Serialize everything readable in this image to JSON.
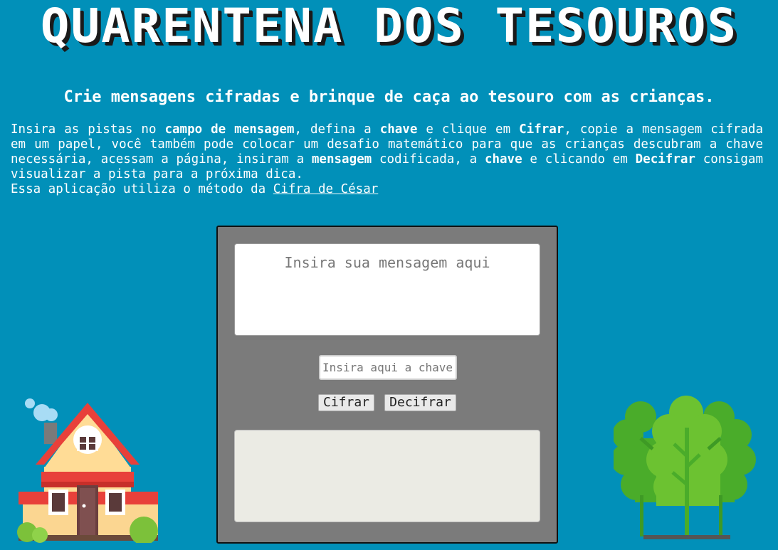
{
  "header": {
    "logo_text": "QUARENTENA DOS TESOUROS",
    "subtitle": "Crie mensagens cifradas e brinque de caça ao tesouro com as crianças."
  },
  "intro": {
    "t1": "Insira as pistas no ",
    "b1": "campo de mensagem",
    "t2": ", defina a ",
    "b2": "chave",
    "t3": " e clique em ",
    "b3": "Cifrar",
    "t4": ", copie a mensagem cifrada em um papel, você também pode colocar um desafio matemático para que as crianças descubram a chave necessária, acessam a página, insiram a ",
    "b4": "mensagem",
    "t5": " codificada, a ",
    "b5": "chave",
    "t6": " e clicando em ",
    "b6": "Decifrar",
    "t7": " consigam visualizar a pista para a próxima dica.",
    "t8": "Essa aplicação utiliza o método da ",
    "link": "Cifra de César"
  },
  "form": {
    "message_placeholder": "Insira sua mensagem aqui",
    "key_placeholder": "Insira aqui a chave",
    "encrypt_label": "Cifrar",
    "decrypt_label": "Decifrar",
    "output_value": ""
  },
  "colors": {
    "background": "#0190b9",
    "panel": "#7b7b7b",
    "output": "#ebebe4"
  },
  "icons": {
    "house": "house-icon",
    "trees": "trees-icon"
  }
}
